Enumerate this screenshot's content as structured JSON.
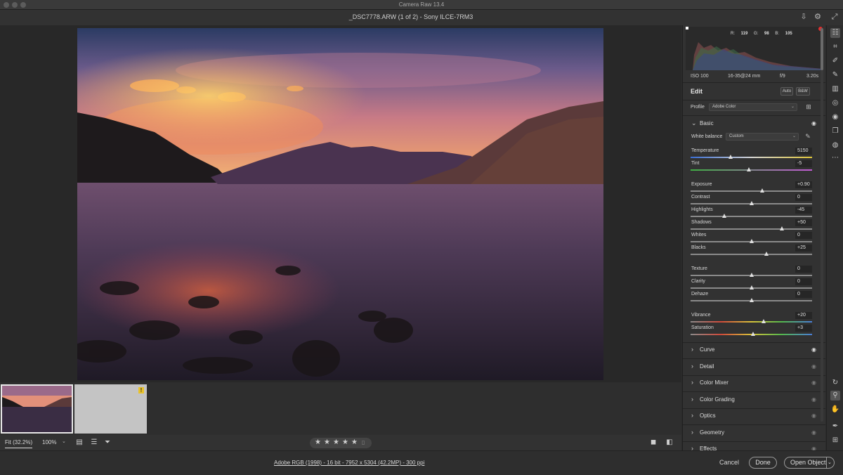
{
  "app": {
    "title": "Camera Raw 13.4"
  },
  "header": {
    "document_title": "_DSC7778.ARW (1 of 2)  -  Sony ILCE-7RM3",
    "icons": [
      "save-icon",
      "gear-icon",
      "fullscreen-icon"
    ]
  },
  "histogram": {
    "r_label": "R:",
    "r_value": "119",
    "g_label": "G:",
    "g_value": "98",
    "b_label": "B:",
    "b_value": "105"
  },
  "camera_meta": {
    "iso": "ISO 100",
    "lens": "16-35@24 mm",
    "aperture": "f/9",
    "shutter": "3.20s"
  },
  "edit": {
    "title": "Edit",
    "auto_label": "Auto",
    "bw_label": "B&W",
    "profile_label": "Profile",
    "profile_value": "Adobe Color"
  },
  "basic": {
    "title": "Basic",
    "white_balance_label": "White balance",
    "white_balance_value": "Custom",
    "sliders": [
      {
        "label": "Temperature",
        "value": "5150",
        "pos": 0.33,
        "track": "temp"
      },
      {
        "label": "Tint",
        "value": "-5",
        "pos": 0.48,
        "track": "tint"
      },
      {
        "label": "Exposure",
        "value": "+0.90",
        "pos": 0.59,
        "track": ""
      },
      {
        "label": "Contrast",
        "value": "0",
        "pos": 0.5,
        "track": ""
      },
      {
        "label": "Highlights",
        "value": "-45",
        "pos": 0.275,
        "track": ""
      },
      {
        "label": "Shadows",
        "value": "+50",
        "pos": 0.75,
        "track": ""
      },
      {
        "label": "Whites",
        "value": "0",
        "pos": 0.5,
        "track": ""
      },
      {
        "label": "Blacks",
        "value": "+25",
        "pos": 0.625,
        "track": ""
      },
      {
        "label": "Texture",
        "value": "0",
        "pos": 0.5,
        "track": ""
      },
      {
        "label": "Clarity",
        "value": "0",
        "pos": 0.5,
        "track": ""
      },
      {
        "label": "Dehaze",
        "value": "0",
        "pos": 0.5,
        "track": ""
      },
      {
        "label": "Vibrance",
        "value": "+20",
        "pos": 0.6,
        "track": "sat"
      },
      {
        "label": "Saturation",
        "value": "+3",
        "pos": 0.515,
        "track": "sat"
      }
    ]
  },
  "sections": [
    {
      "name": "Curve",
      "visible": true
    },
    {
      "name": "Detail",
      "visible": false
    },
    {
      "name": "Color Mixer",
      "visible": false
    },
    {
      "name": "Color Grading",
      "visible": false
    },
    {
      "name": "Optics",
      "visible": false
    },
    {
      "name": "Geometry",
      "visible": false
    },
    {
      "name": "Effects",
      "visible": false
    }
  ],
  "toolbar": {
    "zoom_fit": "Fit (32.2%)",
    "zoom_100": "100%",
    "stars": [
      "★",
      "★",
      "★",
      "★",
      "★"
    ]
  },
  "footer": {
    "file_info": "Adobe RGB (1998) - 16 bit - 7952 x 5304 (42.2MP) - 300 ppi",
    "cancel_label": "Cancel",
    "done_label": "Done",
    "open_label": "Open Object"
  },
  "filmstrip": {
    "warning_badge": "!"
  },
  "tools": [
    "edit-icon",
    "crop-icon",
    "healing-icon",
    "brush-icon",
    "gradient-icon",
    "radial-icon",
    "redeye-icon",
    "snapshots-icon",
    "presets-icon",
    "more-icon",
    "rotate-icon",
    "zoom-icon",
    "hand-icon",
    "sampler-icon",
    "grid-icon"
  ],
  "colors": {
    "accent": "#e8c22a",
    "panel_bg": "#323232",
    "canvas_bg": "#282828"
  }
}
